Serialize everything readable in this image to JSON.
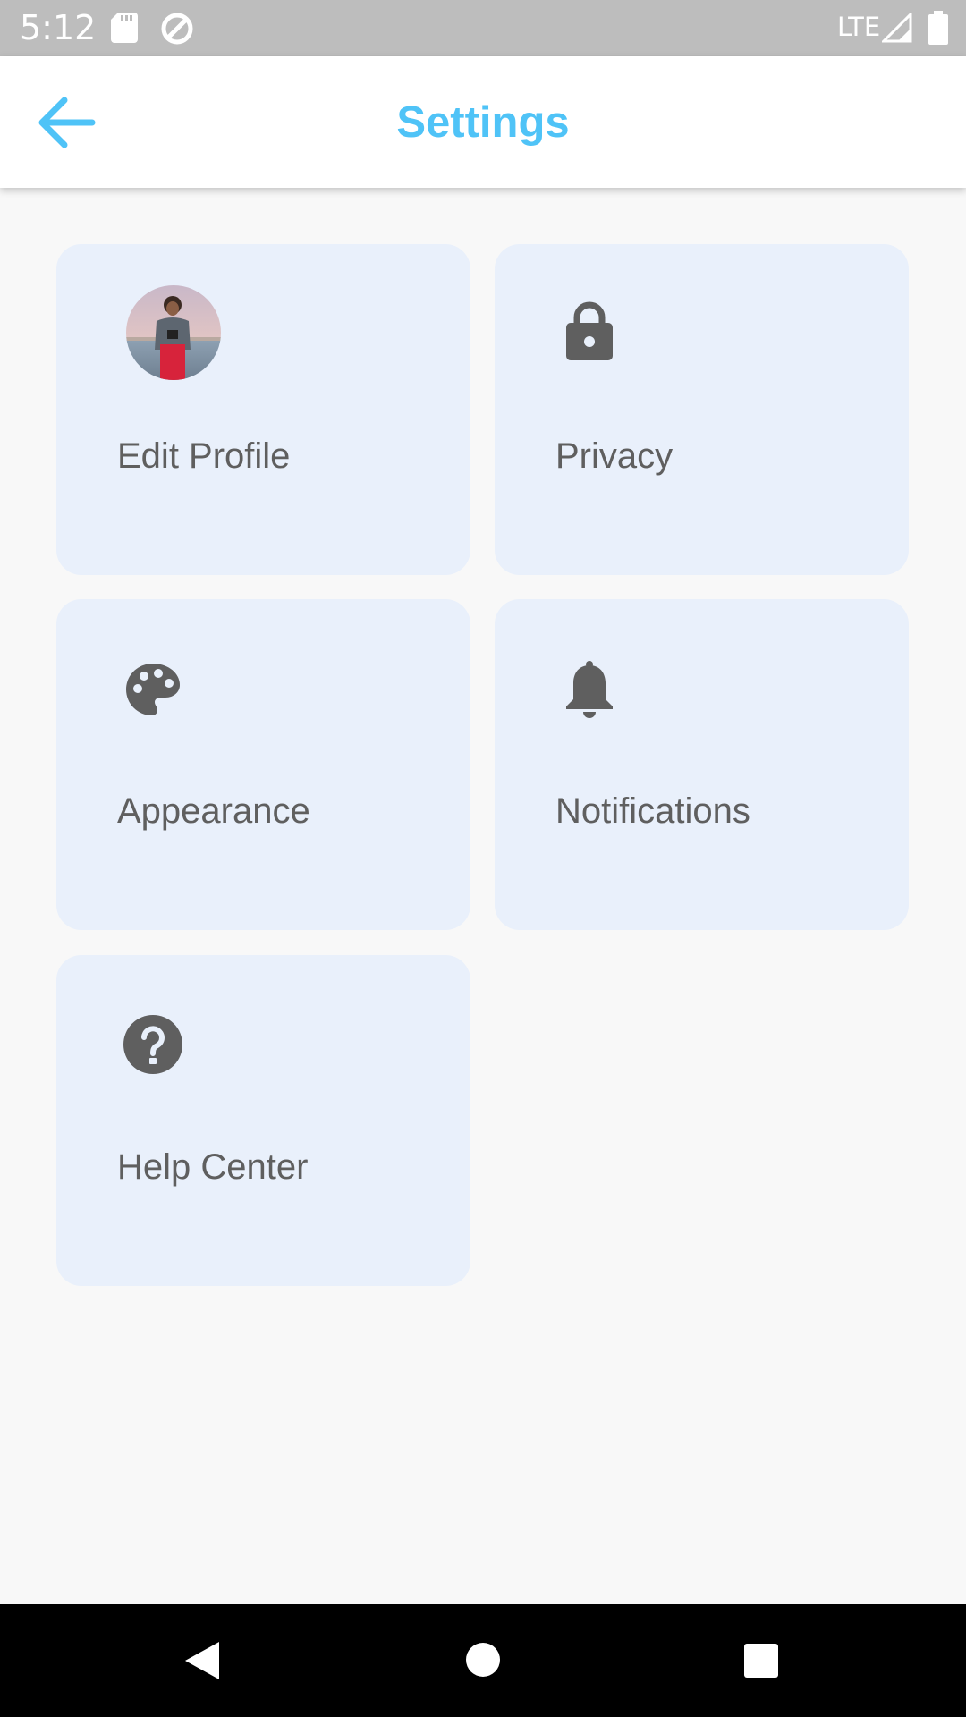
{
  "status_bar": {
    "time": "5:12",
    "network": "LTE",
    "icons": [
      "sd-card-icon",
      "data-saver-icon",
      "signal-icon",
      "battery-icon"
    ]
  },
  "app_bar": {
    "title": "Settings",
    "back_icon": "arrow-back-icon"
  },
  "cards": [
    {
      "label": "Edit Profile",
      "icon": "avatar"
    },
    {
      "label": "Privacy",
      "icon": "lock-icon"
    },
    {
      "label": "Appearance",
      "icon": "palette-icon"
    },
    {
      "label": "Notifications",
      "icon": "bell-icon"
    },
    {
      "label": "Help Center",
      "icon": "help-circle-icon"
    }
  ],
  "nav_bar": {
    "buttons": [
      "back-triangle-icon",
      "home-circle-icon",
      "recents-square-icon"
    ]
  },
  "colors": {
    "accent": "#4fc3f7",
    "card_background": "#e9f0fb",
    "icon": "#5f5f5f",
    "status_bar": "#bdbdbd"
  }
}
